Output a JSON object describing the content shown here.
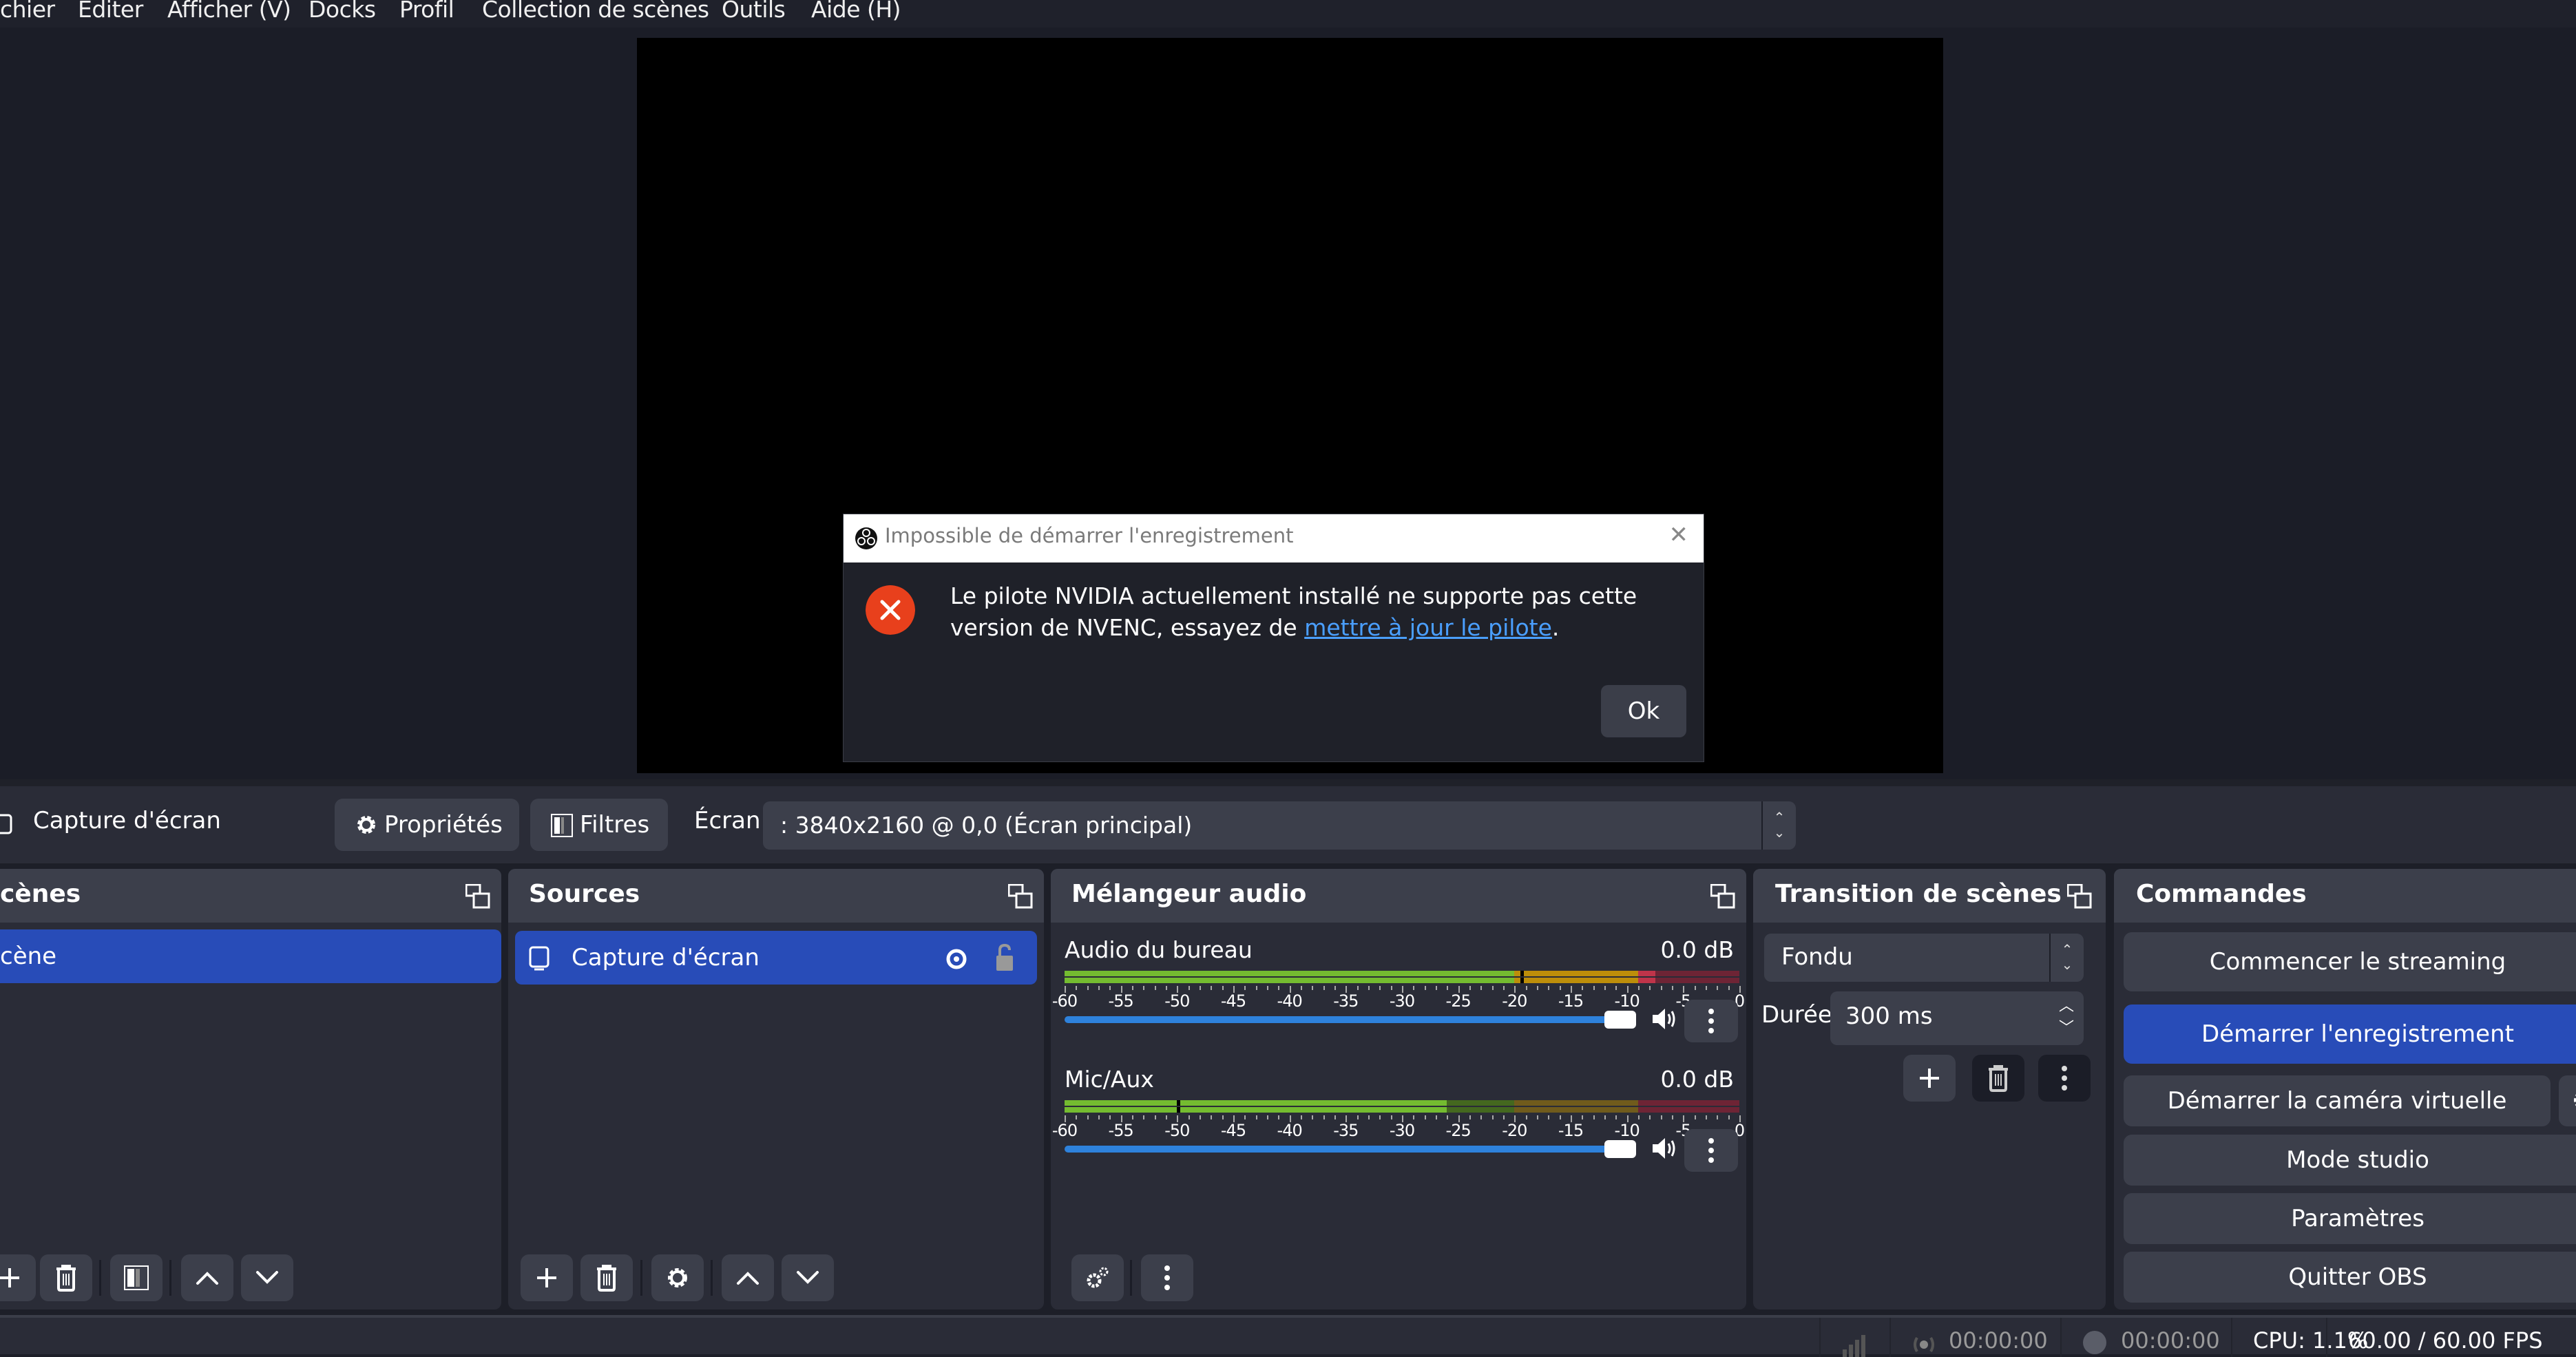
{
  "menu": [
    "chier",
    "Editer",
    "Afficher (V)",
    "Docks",
    "Profil",
    "Collection de scènes",
    "Outils",
    "Aide (H)"
  ],
  "dialog": {
    "title": "Impossible de démarrer l'enregistrement",
    "message_before": "Le pilote NVIDIA actuellement installé ne supporte pas cette version de NVENC, essayez de ",
    "link": "mettre à jour le pilote",
    "message_after": ".",
    "ok_label": "Ok",
    "close_glyph": "✕"
  },
  "source_toolbar": {
    "source_name": "Capture d'écran",
    "properties_label": "Propriétés",
    "filters_label": "Filtres",
    "screen_label": "Écran",
    "screen_value": ": 3840x2160 @ 0,0 (Écran principal)"
  },
  "scenes": {
    "title": "cènes",
    "items": [
      "cène"
    ]
  },
  "sources": {
    "title": "Sources",
    "items": [
      {
        "name": "Capture d'écran",
        "visible": true,
        "locked": false
      }
    ]
  },
  "mixer": {
    "title": "Mélangeur audio",
    "scale": [
      "-60",
      "-55",
      "-50",
      "-45",
      "-40",
      "-35",
      "-30",
      "-25",
      "-20",
      "-15",
      "-10",
      "-5",
      "0"
    ],
    "channels": [
      {
        "name": "Audio du bureau",
        "db": "0.0 dB",
        "volume": 1.0,
        "level_db": -20,
        "peak_db": -19.5
      },
      {
        "name": "Mic/Aux",
        "db": "0.0 dB",
        "volume": 1.0,
        "level_db": -26,
        "peak_db": -50
      }
    ]
  },
  "transitions": {
    "title": "Transition de scènes",
    "selected": "Fondu",
    "duration_label": "Durée",
    "duration_value": "300 ms"
  },
  "controls": {
    "title": "Commandes",
    "buttons": [
      "Commencer le streaming",
      "Démarrer l'enregistrement",
      "Démarrer la caméra virtuelle",
      "Mode studio",
      "Paramètres",
      "Quitter OBS"
    ]
  },
  "status": {
    "stream_time": "00:00:00",
    "record_time": "00:00:00",
    "cpu": "CPU: 1.1%",
    "fps": "60.00 / 60.00 FPS"
  },
  "colors": {
    "accent": "#284cb8",
    "link": "#4a9fff",
    "error": "#e8401c",
    "meter_green": "#74bc30",
    "meter_yellow": "#bd8e0a",
    "meter_red": "#c0344a",
    "slider": "#2e82dc"
  }
}
